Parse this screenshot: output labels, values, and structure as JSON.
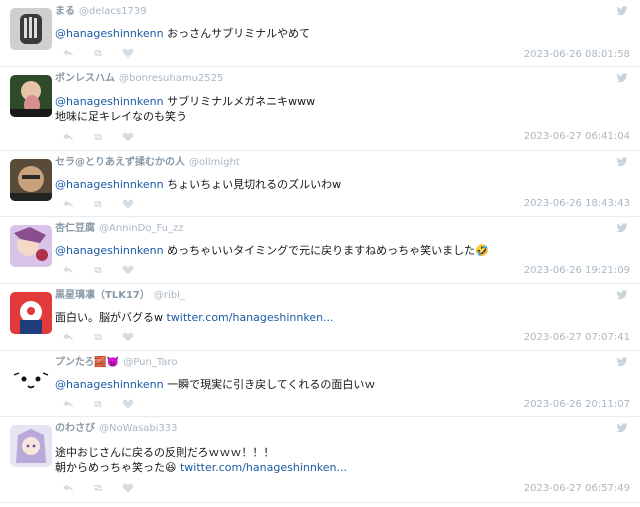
{
  "tweets": [
    {
      "name": "まる",
      "handle": "@delacs1739",
      "mention": "@hanageshinnkenn",
      "line1": "おっさんサブリミナルやめて",
      "line2": "",
      "link": "",
      "timestamp": "2023-06-26 08:01:58"
    },
    {
      "name": "ボンレスハム",
      "handle": "@bonresuhamu2525",
      "mention": "@hanageshinnkenn",
      "line1": "サブリミナルメガネニキwww",
      "line2": "地味に足キレイなのも笑う",
      "link": "",
      "timestamp": "2023-06-27 06:41:04"
    },
    {
      "name": "セラ@とりあえず揉むかの人",
      "handle": "@ollmight",
      "mention": "@hanageshinnkenn",
      "line1": "ちょいちょい見切れるのズルいわw",
      "line2": "",
      "link": "",
      "timestamp": "2023-06-26 18:43:43"
    },
    {
      "name": "杏仁豆腐",
      "handle": "@AnninDo_Fu_zz",
      "mention": "@hanageshinnkenn",
      "line1": "めっちゃいいタイミングで元に戻りますねめっちゃ笑いました🤣",
      "line2": "",
      "link": "",
      "timestamp": "2023-06-26 19:21:09"
    },
    {
      "name": "黒星璃凛（TLK17）",
      "handle": "@ribl_",
      "mention": "",
      "line1": "面白い。脳がバグるw",
      "line2": "",
      "link": "twitter.com/hanageshinnken...",
      "timestamp": "2023-06-27 07:07:41"
    },
    {
      "name": "プンたろ🧱👿",
      "handle": "@Pun_Taro",
      "mention": "@hanageshinnkenn",
      "line1": "一瞬で現実に引き戻してくれるの面白いｗ",
      "line2": "",
      "link": "",
      "timestamp": "2023-06-26 20:11:07"
    },
    {
      "name": "のわさび",
      "handle": "@NoWasabi333",
      "mention": "",
      "line1": "途中おじさんに戻るの反則だろｗｗｗ！！！",
      "line2": "朝からめっちゃ笑った😆",
      "link": "twitter.com/hanageshinnken...",
      "timestamp": "2023-06-27 06:57:49"
    }
  ],
  "icons": {
    "reply": "reply-icon",
    "retweet": "retweet-icon",
    "like": "heart-icon",
    "bird": "twitter-bird-icon"
  },
  "colors": {
    "mention": "#1b5aa6",
    "muted": "#aab8c2",
    "name": "#8899a6",
    "divider": "#e6ecf0"
  }
}
